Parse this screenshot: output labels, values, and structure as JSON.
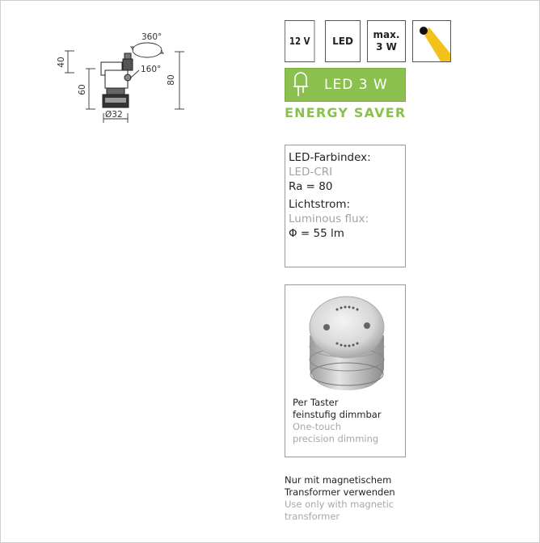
{
  "drawing": {
    "rotation_label": "360°",
    "tilt_label": "160°",
    "dim_40": "40",
    "dim_60": "60",
    "dim_80": "80",
    "dim_diameter": "Ø32"
  },
  "specs": {
    "voltage": "12 V",
    "type": "LED",
    "max_line1": "max.",
    "max_line2": "3 W",
    "icon": "spotlight-beam-icon"
  },
  "led_banner": {
    "text": "LED  3 W",
    "color": "#8cc04e",
    "icon": "led-bulb-icon"
  },
  "energy_saver": "ENERGY SAVER",
  "info": {
    "cri_de": "LED-Farbindex:",
    "cri_en": "LED-CRI",
    "cri_value": "Ra = 80",
    "flux_de": "Lichtstrom:",
    "flux_en": "Luminous flux:",
    "flux_value": "Φ  = 55 lm"
  },
  "dimmer": {
    "line1_de": "Per Taster",
    "line2_de": "feinstufig dimmbar",
    "line1_en": "One-touch",
    "line2_en": "precision dimming"
  },
  "note": {
    "line1_de": "Nur mit magnetischem",
    "line2_de": "Transformer verwenden",
    "line1_en": "Use only with magnetic",
    "line2_en": "transformer"
  }
}
